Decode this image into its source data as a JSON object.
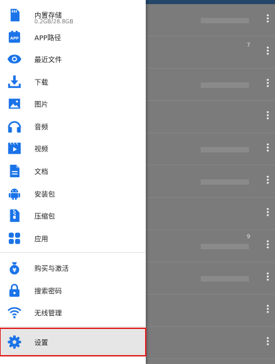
{
  "drawer": {
    "storage": {
      "label": "内置存储",
      "detail": "0.2GB/28.8GB",
      "icon": "sd-card-icon"
    },
    "items": [
      {
        "key": "app-path",
        "label": "APP路径",
        "icon": "app-box-icon"
      },
      {
        "key": "recent",
        "label": "最近文件",
        "icon": "eye-icon"
      },
      {
        "key": "download",
        "label": "下载",
        "icon": "download-icon"
      },
      {
        "key": "pictures",
        "label": "图片",
        "icon": "image-icon"
      },
      {
        "key": "audio",
        "label": "音频",
        "icon": "headphones-icon"
      },
      {
        "key": "video",
        "label": "视频",
        "icon": "video-icon"
      },
      {
        "key": "documents",
        "label": "文档",
        "icon": "document-icon"
      },
      {
        "key": "apk",
        "label": "安装包",
        "icon": "android-icon"
      },
      {
        "key": "archives",
        "label": "压缩包",
        "icon": "zip-icon"
      },
      {
        "key": "apps",
        "label": "应用",
        "icon": "grid-icon"
      }
    ],
    "extras": [
      {
        "key": "purchase",
        "label": "购买与激活",
        "icon": "money-bag-icon"
      },
      {
        "key": "password",
        "label": "搜索密码",
        "icon": "lock-icon"
      },
      {
        "key": "wireless",
        "label": "无线管理",
        "icon": "wifi-icon"
      }
    ],
    "settings": {
      "label": "设置",
      "icon": "gear-icon"
    }
  },
  "background_list": {
    "numbers": [
      "7",
      "9"
    ]
  },
  "colors": {
    "accent": "#1a73e8",
    "highlight": "#e02020",
    "topbar": "#24466a"
  }
}
